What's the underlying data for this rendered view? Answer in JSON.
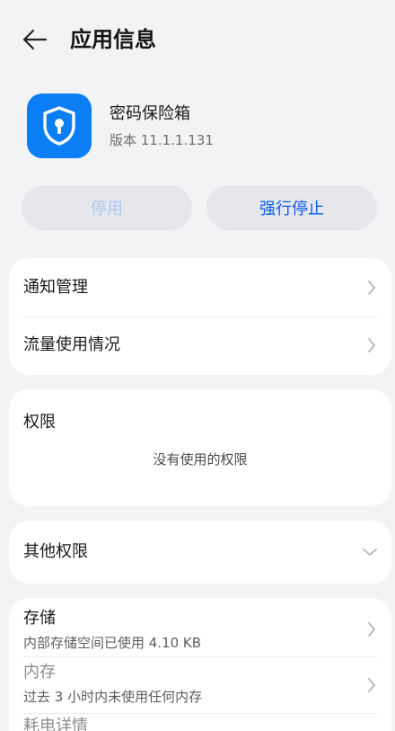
{
  "header": {
    "title": "应用信息",
    "back_icon": "arrow-left-icon"
  },
  "app": {
    "name": "密码保险箱",
    "version": "版本 11.1.1.131",
    "icon": "shield-lock-icon",
    "icon_color": "#0b7df5"
  },
  "buttons": {
    "disable": "停用",
    "force_stop": "强行停止"
  },
  "settings": {
    "notification": "通知管理",
    "data_usage": "流量使用情况"
  },
  "permissions": {
    "title": "权限",
    "empty": "没有使用的权限"
  },
  "other_permissions": {
    "title": "其他权限"
  },
  "storage": {
    "title": "存储",
    "desc": "内部存储空间已使用 4.10 KB",
    "memory_title": "内存",
    "memory_desc": "过去 3 小时内未使用任何内存",
    "battery_title": "耗电详情"
  },
  "colors": {
    "accent": "#0a59f7",
    "background": "#f1f3f5",
    "card": "#ffffff"
  }
}
